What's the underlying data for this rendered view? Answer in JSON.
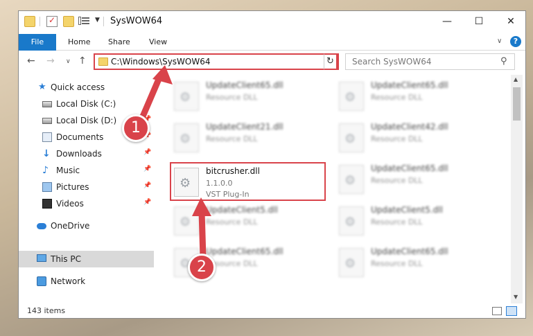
{
  "window": {
    "title": "SysWOW64",
    "min_glyph": "—",
    "max_glyph": "☐",
    "close_glyph": "✕"
  },
  "ribbon": {
    "tabs": [
      "File",
      "Home",
      "Share",
      "View"
    ],
    "help_glyph": "?"
  },
  "address": {
    "path": "C:\\Windows\\SysWOW64",
    "search_placeholder": "Search SysWOW64"
  },
  "nav_pane": {
    "items": [
      {
        "label": "Quick access",
        "icon": "star-icon"
      },
      {
        "label": "Local Disk (C:)",
        "icon": "drive-icon"
      },
      {
        "label": "Local Disk (D:)",
        "icon": "drive-icon"
      },
      {
        "label": "Documents",
        "icon": "documents-icon"
      },
      {
        "label": "Downloads",
        "icon": "download-icon"
      },
      {
        "label": "Music",
        "icon": "music-icon"
      },
      {
        "label": "Pictures",
        "icon": "pictures-icon"
      },
      {
        "label": "Videos",
        "icon": "videos-icon"
      },
      {
        "label": "OneDrive",
        "icon": "onedrive-icon"
      },
      {
        "label": "This PC",
        "icon": "pc-icon"
      },
      {
        "label": "Network",
        "icon": "network-icon"
      }
    ]
  },
  "files": [
    {
      "name": "UpdateClient65.dll",
      "desc": "Resource DLL"
    },
    {
      "name": "UpdateClient65.dll",
      "desc": "Resource DLL"
    },
    {
      "name": "UpdateClient21.dll",
      "desc": "Resource DLL"
    },
    {
      "name": "UpdateClient42.dll",
      "desc": "Resource DLL"
    },
    {
      "name": "bitcrusher.dll",
      "version": "1.1.0.0",
      "desc": "VST Plug-In"
    },
    {
      "name": "UpdateClient65.dll",
      "desc": "Resource DLL"
    },
    {
      "name": "UpdateClient5.dll",
      "desc": "Resource DLL"
    },
    {
      "name": "UpdateClient5.dll",
      "desc": "Resource DLL"
    },
    {
      "name": "UpdateClient65.dll",
      "desc": "Resource DLL"
    },
    {
      "name": "UpdateClient65.dll",
      "desc": "Resource DLL"
    }
  ],
  "status": {
    "item_count": "143 items"
  },
  "annotations": {
    "step1": "1",
    "step2": "2",
    "color": "#d9434a"
  },
  "colors": {
    "accent": "#1979ca",
    "highlight": "#d9434a"
  }
}
